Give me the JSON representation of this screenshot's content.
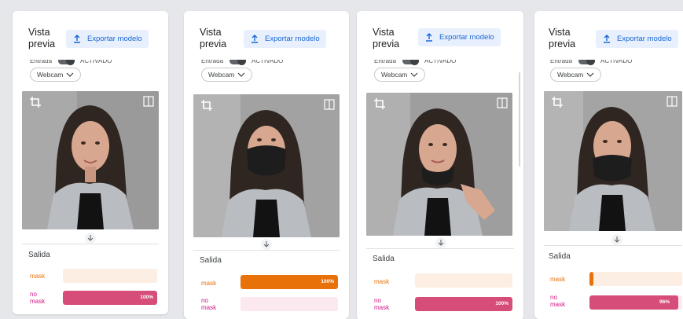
{
  "colors": {
    "accent": "#1967d2",
    "mask": "#e8710a",
    "no_mask": "#d64d79"
  },
  "panels": [
    {
      "title_line1": "Vista",
      "title_line2": "previa",
      "export_label": "Exportar modelo",
      "entrada_label": "Entrada",
      "toggle_label": "ACTIVADO",
      "webcam_label": "Webcam",
      "output_label": "Salida",
      "classes": [
        {
          "label": "mask",
          "value": 0,
          "pct_text": ""
        },
        {
          "label_line1": "no",
          "label_line2": "mask",
          "value": 100,
          "pct_text": "100%"
        }
      ]
    },
    {
      "title_line1": "Vista",
      "title_line2": "previa",
      "export_label": "Exportar modelo",
      "entrada_label": "Entrada",
      "toggle_label": "ACTIVADO",
      "webcam_label": "Webcam",
      "output_label": "Salida",
      "classes": [
        {
          "label": "mask",
          "value": 100,
          "pct_text": "100%"
        },
        {
          "label_line1": "no",
          "label_line2": "mask",
          "value": 0,
          "pct_text": ""
        }
      ]
    },
    {
      "title_line1": "Vista",
      "title_line2": "previa",
      "export_label": "Exportar modelo",
      "entrada_label": "Entrada",
      "toggle_label": "ACTIVADO",
      "webcam_label": "Webcam",
      "output_label": "Salida",
      "classes": [
        {
          "label": "mask",
          "value": 0,
          "pct_text": ""
        },
        {
          "label_line1": "no",
          "label_line2": "mask",
          "value": 100,
          "pct_text": "100%"
        }
      ]
    },
    {
      "title_line1": "Vista",
      "title_line2": "previa",
      "export_label": "Exportar modelo",
      "entrada_label": "Entrada",
      "toggle_label": "ACTIVADO",
      "webcam_label": "Webcam",
      "output_label": "Salida",
      "classes": [
        {
          "label": "mask",
          "value": 4,
          "pct_text": ""
        },
        {
          "label_line1": "no",
          "label_line2": "mask",
          "value": 96,
          "pct_text": "96%"
        }
      ]
    }
  ],
  "icons": {
    "export": "upload-icon",
    "crop": "crop-icon",
    "flip": "flip-icon",
    "arrow": "arrow-down-icon",
    "dropdown": "chevron-down-icon"
  }
}
